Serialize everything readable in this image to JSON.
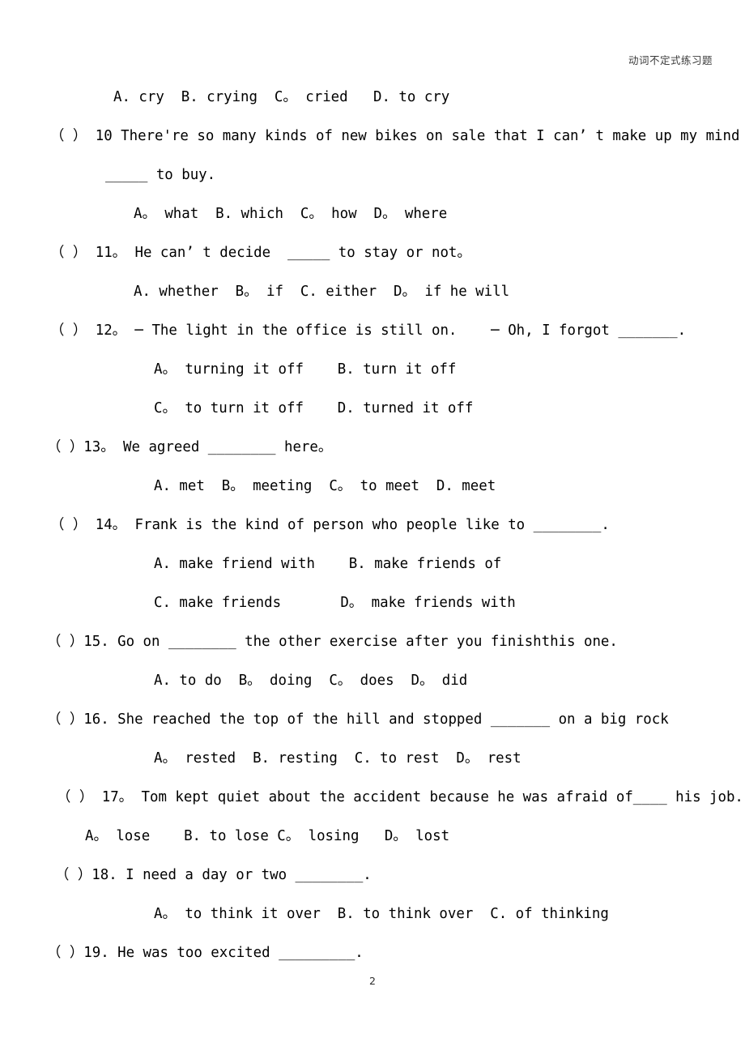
{
  "document": {
    "header_title": "动词不定式练习题",
    "page_number": "2",
    "title_icon": "document-icon"
  },
  "lines": [
    {
      "id": "q9-options",
      "indent": "ind-opt",
      "text": "A. cry  B. crying  C。 cried   D. to cry"
    },
    {
      "id": "q10-stem",
      "indent": "ind-q1",
      "text": "（ ） 10 There're so many kinds of new bikes on sale that I can’ t make up my mind"
    },
    {
      "id": "q10-cont",
      "indent": "ind-cont",
      "text": "_____ to buy."
    },
    {
      "id": "q10-options",
      "indent": "ind-optA",
      "text": "A。 what  B. which  C。 how  D。 where"
    },
    {
      "id": "q11-stem",
      "indent": "ind-q1",
      "text": "（ ） 11。 He can’ t decide  _____ to stay or not。"
    },
    {
      "id": "q11-options",
      "indent": "ind-optA",
      "text": "A. whether  B。 if  C. either  D。 if he will"
    },
    {
      "id": "q12-stem",
      "indent": "ind-q1",
      "text": "（ ） 12。 ─ The light in the office is still on.    ─ Oh, I forgot _______."
    },
    {
      "id": "q12-optionsAB",
      "indent": "ind-optB",
      "text": "A。 turning it off    B. turn it off"
    },
    {
      "id": "q12-optionsCD",
      "indent": "ind-optB",
      "text": "C。 to turn it off    D. turned it off"
    },
    {
      "id": "q13-stem",
      "indent": "ind-q0",
      "text": "（ ）13。 We agreed ________ here。"
    },
    {
      "id": "q13-options",
      "indent": "ind-optB",
      "text": "A. met  B。 meeting  C。 to meet  D. meet"
    },
    {
      "id": "q14-stem",
      "indent": "ind-q1",
      "text": "（ ） 14。 Frank is the kind of person who people like to ________."
    },
    {
      "id": "q14-optionsAB",
      "indent": "ind-optB",
      "text": "A. make friend with    B. make friends of"
    },
    {
      "id": "q14-optionsCD",
      "indent": "ind-optB",
      "text": "C. make friends       D。 make friends with"
    },
    {
      "id": "q15-stem",
      "indent": "ind-q0",
      "text": "（ ）15. Go on ________ the other exercise after you finishthis one."
    },
    {
      "id": "q15-options",
      "indent": "ind-optB",
      "text": "A. to do  B。 doing  C。 does  D。 did"
    },
    {
      "id": "q16-stem",
      "indent": "ind-q0",
      "text": "（ ）16. She reached the top of the hill and stopped _______ on a big rock"
    },
    {
      "id": "q16-options",
      "indent": "ind-optB",
      "text": "A。 rested  B. resting  C. to rest  D。 rest"
    },
    {
      "id": "q17-stem",
      "indent": "ind-q2",
      "text": "（ ） 17。 Tom kept quiet about the accident because he was afraid of____ his job."
    },
    {
      "id": "q17-options",
      "indent": "ind-optD",
      "text": "A。 lose    B. to lose C。 losing   D。 lost"
    },
    {
      "id": "q18-stem",
      "indent": "ind-q3",
      "text": "（ ）18. I need a day or two ________."
    },
    {
      "id": "q18-options",
      "indent": "ind-optB",
      "text": "A。 to think it over  B. to think over  C. of thinking"
    },
    {
      "id": "q19-stem",
      "indent": "ind-q0",
      "text": "（ ）19. He was too excited _________."
    }
  ]
}
